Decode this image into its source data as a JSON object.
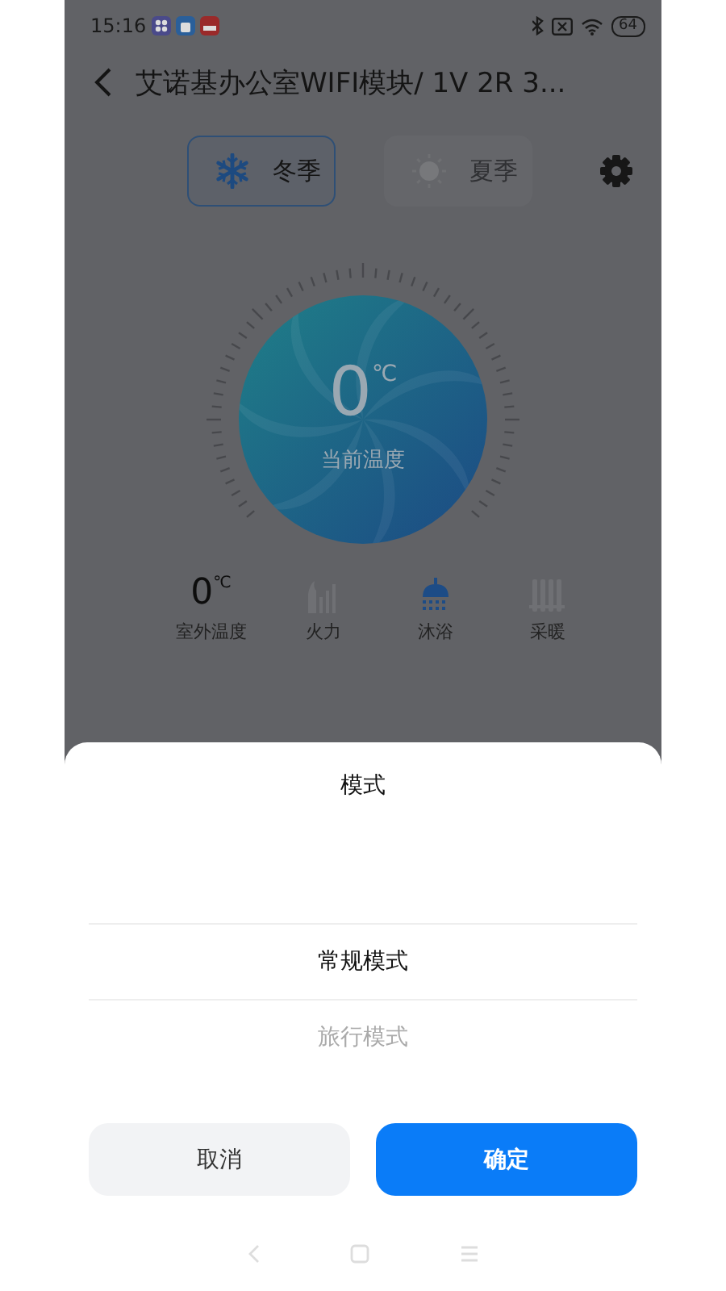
{
  "status_bar": {
    "time": "15:16",
    "battery": "64"
  },
  "header": {
    "title": "艾诺基办公室WIFI模块/ 1V 2R 3..."
  },
  "seasons": [
    {
      "kind": "winter",
      "label": "冬季",
      "selected": true
    },
    {
      "kind": "summer",
      "label": "夏季",
      "selected": false
    }
  ],
  "gauge": {
    "value": "0",
    "unit": "℃",
    "label": "当前温度"
  },
  "stats": [
    {
      "kind": "temperature",
      "value": "0",
      "unit": "℃",
      "label": "室外温度"
    },
    {
      "kind": "flame",
      "label": "火力",
      "on": false
    },
    {
      "kind": "shower",
      "label": "沐浴",
      "on": true
    },
    {
      "kind": "radiator",
      "label": "采暖",
      "on": false
    }
  ],
  "sheet": {
    "title": "模式",
    "options": [
      {
        "label": "常规模式",
        "selected": true
      },
      {
        "label": "旅行模式",
        "selected": false
      }
    ],
    "buttons": [
      {
        "kind": "cancel",
        "label": "取消"
      },
      {
        "kind": "confirm",
        "label": "确定"
      }
    ]
  }
}
